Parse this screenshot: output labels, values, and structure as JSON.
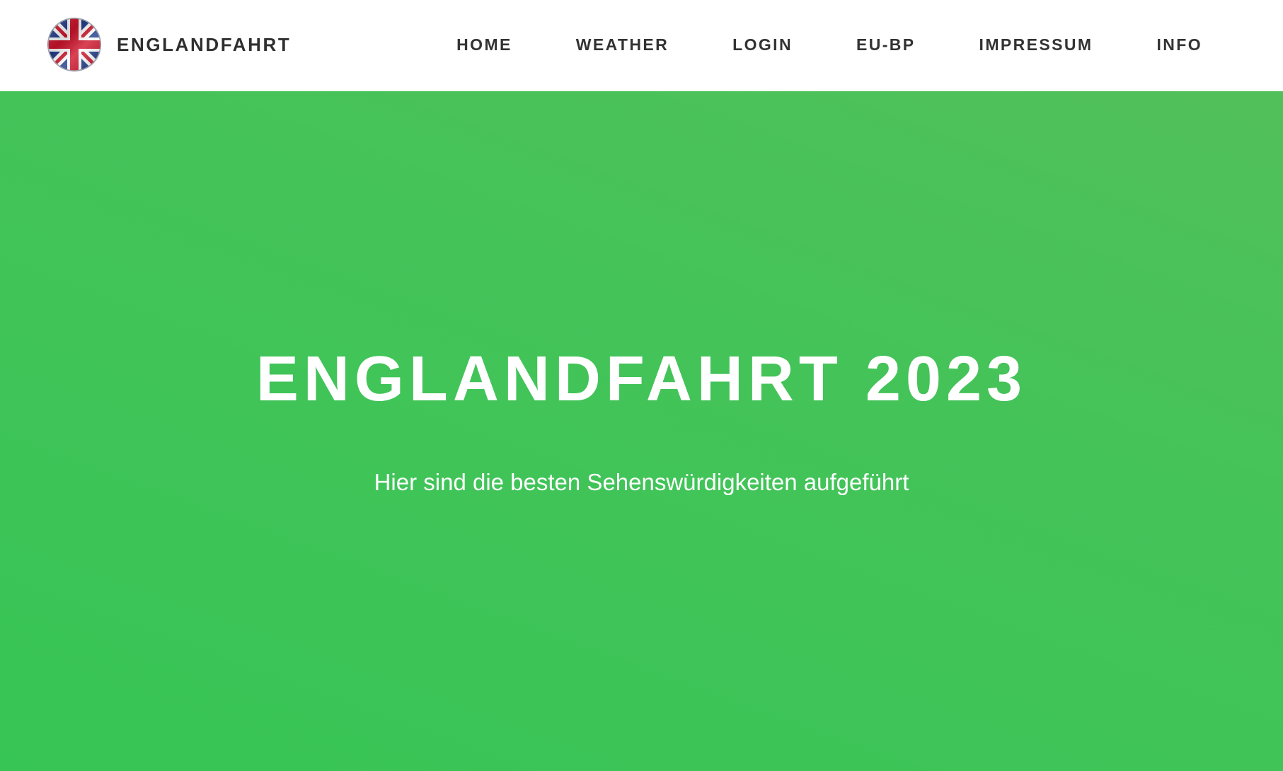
{
  "brand": {
    "name": "ENGLANDFAHRT",
    "logo_icon": "union-jack-flag-icon",
    "logo_alt": "Union Jack"
  },
  "nav": {
    "items": [
      {
        "label": "HOME"
      },
      {
        "label": "WEATHER"
      },
      {
        "label": "LOGIN"
      },
      {
        "label": "EU-BP"
      },
      {
        "label": "IMPRESSUM"
      },
      {
        "label": "INFO"
      }
    ]
  },
  "hero": {
    "title": "ENGLANDFAHRT 2023",
    "subtitle": "Hier sind die besten Sehenswürdigkeiten aufgeführt"
  },
  "colors": {
    "header_bg": "#ffffff",
    "hero_green": "#3cc556",
    "hero_green_light": "#52c05a",
    "nav_text": "#333333",
    "hero_text": "#ffffff",
    "flag_blue": "#1f3a8a",
    "flag_red": "#d0142c",
    "flag_white": "#ffffff"
  }
}
